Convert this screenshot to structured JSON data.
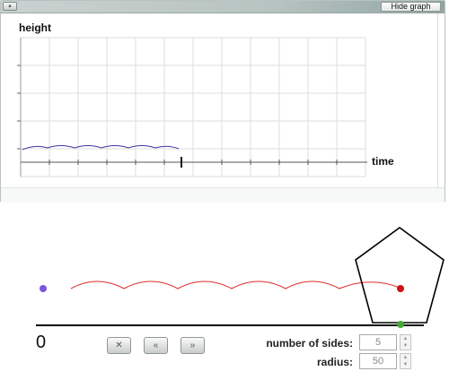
{
  "graph": {
    "collapse_icon": "▴",
    "hide_button": "Hide graph",
    "y_label": "height",
    "x_label": "time"
  },
  "stage": {
    "origin_label": "0"
  },
  "controls": {
    "reset_icon": "✕",
    "rewind_icon": "«",
    "forward_icon": "»"
  },
  "fields": {
    "sides_label": "number of sides:",
    "sides_value": "5",
    "radius_label": "radius:",
    "radius_value": "50"
  },
  "colors": {
    "trace_graph": "#3b35a8",
    "trace_stage": "#e22a2a",
    "start_point": "#7a55e0",
    "tracked_point": "#cc1111",
    "contact_point": "#44aa33"
  }
}
